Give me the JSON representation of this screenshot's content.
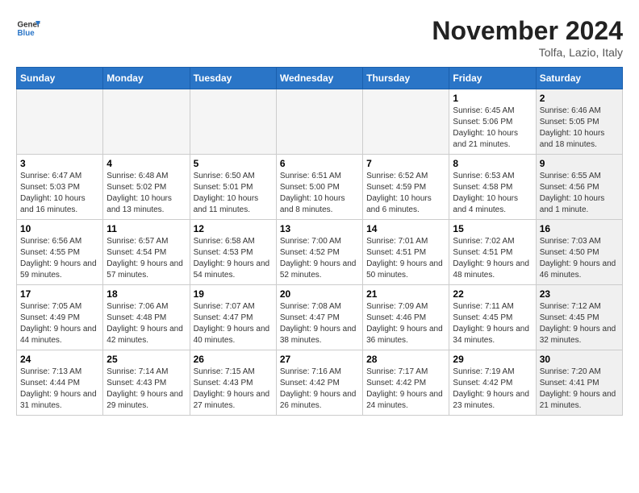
{
  "logo": {
    "line1": "General",
    "line2": "Blue"
  },
  "header": {
    "month": "November 2024",
    "location": "Tolfa, Lazio, Italy"
  },
  "weekdays": [
    "Sunday",
    "Monday",
    "Tuesday",
    "Wednesday",
    "Thursday",
    "Friday",
    "Saturday"
  ],
  "weeks": [
    [
      {
        "day": "",
        "info": "",
        "empty": true
      },
      {
        "day": "",
        "info": "",
        "empty": true
      },
      {
        "day": "",
        "info": "",
        "empty": true
      },
      {
        "day": "",
        "info": "",
        "empty": true
      },
      {
        "day": "",
        "info": "",
        "empty": true
      },
      {
        "day": "1",
        "info": "Sunrise: 6:45 AM\nSunset: 5:06 PM\nDaylight: 10 hours and 21 minutes.",
        "empty": false,
        "shaded": false
      },
      {
        "day": "2",
        "info": "Sunrise: 6:46 AM\nSunset: 5:05 PM\nDaylight: 10 hours and 18 minutes.",
        "empty": false,
        "shaded": true
      }
    ],
    [
      {
        "day": "3",
        "info": "Sunrise: 6:47 AM\nSunset: 5:03 PM\nDaylight: 10 hours and 16 minutes.",
        "empty": false,
        "shaded": false
      },
      {
        "day": "4",
        "info": "Sunrise: 6:48 AM\nSunset: 5:02 PM\nDaylight: 10 hours and 13 minutes.",
        "empty": false,
        "shaded": false
      },
      {
        "day": "5",
        "info": "Sunrise: 6:50 AM\nSunset: 5:01 PM\nDaylight: 10 hours and 11 minutes.",
        "empty": false,
        "shaded": false
      },
      {
        "day": "6",
        "info": "Sunrise: 6:51 AM\nSunset: 5:00 PM\nDaylight: 10 hours and 8 minutes.",
        "empty": false,
        "shaded": false
      },
      {
        "day": "7",
        "info": "Sunrise: 6:52 AM\nSunset: 4:59 PM\nDaylight: 10 hours and 6 minutes.",
        "empty": false,
        "shaded": false
      },
      {
        "day": "8",
        "info": "Sunrise: 6:53 AM\nSunset: 4:58 PM\nDaylight: 10 hours and 4 minutes.",
        "empty": false,
        "shaded": false
      },
      {
        "day": "9",
        "info": "Sunrise: 6:55 AM\nSunset: 4:56 PM\nDaylight: 10 hours and 1 minute.",
        "empty": false,
        "shaded": true
      }
    ],
    [
      {
        "day": "10",
        "info": "Sunrise: 6:56 AM\nSunset: 4:55 PM\nDaylight: 9 hours and 59 minutes.",
        "empty": false,
        "shaded": false
      },
      {
        "day": "11",
        "info": "Sunrise: 6:57 AM\nSunset: 4:54 PM\nDaylight: 9 hours and 57 minutes.",
        "empty": false,
        "shaded": false
      },
      {
        "day": "12",
        "info": "Sunrise: 6:58 AM\nSunset: 4:53 PM\nDaylight: 9 hours and 54 minutes.",
        "empty": false,
        "shaded": false
      },
      {
        "day": "13",
        "info": "Sunrise: 7:00 AM\nSunset: 4:52 PM\nDaylight: 9 hours and 52 minutes.",
        "empty": false,
        "shaded": false
      },
      {
        "day": "14",
        "info": "Sunrise: 7:01 AM\nSunset: 4:51 PM\nDaylight: 9 hours and 50 minutes.",
        "empty": false,
        "shaded": false
      },
      {
        "day": "15",
        "info": "Sunrise: 7:02 AM\nSunset: 4:51 PM\nDaylight: 9 hours and 48 minutes.",
        "empty": false,
        "shaded": false
      },
      {
        "day": "16",
        "info": "Sunrise: 7:03 AM\nSunset: 4:50 PM\nDaylight: 9 hours and 46 minutes.",
        "empty": false,
        "shaded": true
      }
    ],
    [
      {
        "day": "17",
        "info": "Sunrise: 7:05 AM\nSunset: 4:49 PM\nDaylight: 9 hours and 44 minutes.",
        "empty": false,
        "shaded": false
      },
      {
        "day": "18",
        "info": "Sunrise: 7:06 AM\nSunset: 4:48 PM\nDaylight: 9 hours and 42 minutes.",
        "empty": false,
        "shaded": false
      },
      {
        "day": "19",
        "info": "Sunrise: 7:07 AM\nSunset: 4:47 PM\nDaylight: 9 hours and 40 minutes.",
        "empty": false,
        "shaded": false
      },
      {
        "day": "20",
        "info": "Sunrise: 7:08 AM\nSunset: 4:47 PM\nDaylight: 9 hours and 38 minutes.",
        "empty": false,
        "shaded": false
      },
      {
        "day": "21",
        "info": "Sunrise: 7:09 AM\nSunset: 4:46 PM\nDaylight: 9 hours and 36 minutes.",
        "empty": false,
        "shaded": false
      },
      {
        "day": "22",
        "info": "Sunrise: 7:11 AM\nSunset: 4:45 PM\nDaylight: 9 hours and 34 minutes.",
        "empty": false,
        "shaded": false
      },
      {
        "day": "23",
        "info": "Sunrise: 7:12 AM\nSunset: 4:45 PM\nDaylight: 9 hours and 32 minutes.",
        "empty": false,
        "shaded": true
      }
    ],
    [
      {
        "day": "24",
        "info": "Sunrise: 7:13 AM\nSunset: 4:44 PM\nDaylight: 9 hours and 31 minutes.",
        "empty": false,
        "shaded": false
      },
      {
        "day": "25",
        "info": "Sunrise: 7:14 AM\nSunset: 4:43 PM\nDaylight: 9 hours and 29 minutes.",
        "empty": false,
        "shaded": false
      },
      {
        "day": "26",
        "info": "Sunrise: 7:15 AM\nSunset: 4:43 PM\nDaylight: 9 hours and 27 minutes.",
        "empty": false,
        "shaded": false
      },
      {
        "day": "27",
        "info": "Sunrise: 7:16 AM\nSunset: 4:42 PM\nDaylight: 9 hours and 26 minutes.",
        "empty": false,
        "shaded": false
      },
      {
        "day": "28",
        "info": "Sunrise: 7:17 AM\nSunset: 4:42 PM\nDaylight: 9 hours and 24 minutes.",
        "empty": false,
        "shaded": false
      },
      {
        "day": "29",
        "info": "Sunrise: 7:19 AM\nSunset: 4:42 PM\nDaylight: 9 hours and 23 minutes.",
        "empty": false,
        "shaded": false
      },
      {
        "day": "30",
        "info": "Sunrise: 7:20 AM\nSunset: 4:41 PM\nDaylight: 9 hours and 21 minutes.",
        "empty": false,
        "shaded": true
      }
    ]
  ]
}
